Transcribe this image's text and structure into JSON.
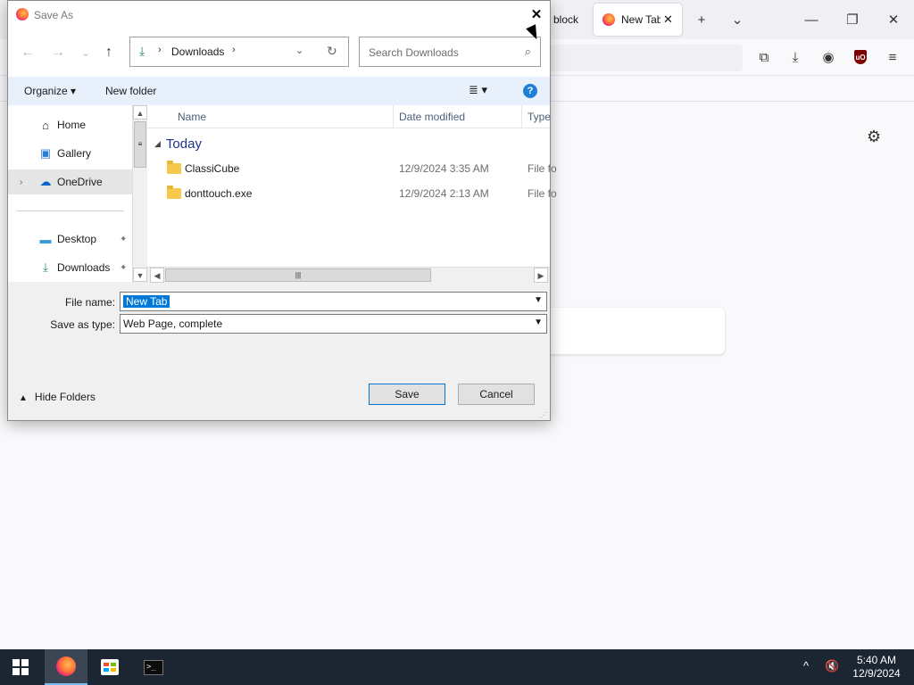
{
  "browser": {
    "tabs": [
      {
        "label": "e block"
      },
      {
        "label": "New Tab",
        "close": "✕"
      }
    ],
    "new_tab": "+",
    "list_tabs": "⌄",
    "minimize": "—",
    "restore": "❐",
    "close": "✕"
  },
  "dialog": {
    "title": "Save As",
    "close": "✕",
    "address": {
      "back": "←",
      "forward": "→",
      "recent": "⌄",
      "up": "↑",
      "location": "Downloads",
      "search_placeholder": "Search Downloads"
    },
    "toolbar": {
      "organize": "Organize ▾",
      "new_folder": "New folder",
      "view": "≣ ▾",
      "help": "?"
    },
    "nav": [
      {
        "label": "Home",
        "icon": "home-icon"
      },
      {
        "label": "Gallery",
        "icon": "gallery-icon"
      },
      {
        "label": "OneDrive",
        "icon": "onedrive-icon"
      },
      {
        "label": "Desktop",
        "icon": "desktop-icon"
      },
      {
        "label": "Downloads",
        "icon": "download-icon"
      }
    ],
    "columns": [
      "Name",
      "Date modified",
      "Type"
    ],
    "group": "Today",
    "files": [
      {
        "name": "ClassiCube",
        "date": "12/9/2024 3:35 AM",
        "type": "File fo"
      },
      {
        "name": "donttouch.exe",
        "date": "12/9/2024 2:13 AM",
        "type": "File fo"
      }
    ],
    "file_name_label": "File name:",
    "file_name_value": "New Tab",
    "save_type_label": "Save as type:",
    "save_type_value": "Web Page, complete",
    "hide_folders": "Hide Folders",
    "save": "Save",
    "cancel": "Cancel"
  },
  "taskbar": {
    "time": "5:40 AM",
    "date": "12/9/2024",
    "tray_chevron": "^"
  },
  "colors": {
    "accent": "#0078d7",
    "taskbar": "#1c2633",
    "group_header": "#1e3287"
  }
}
